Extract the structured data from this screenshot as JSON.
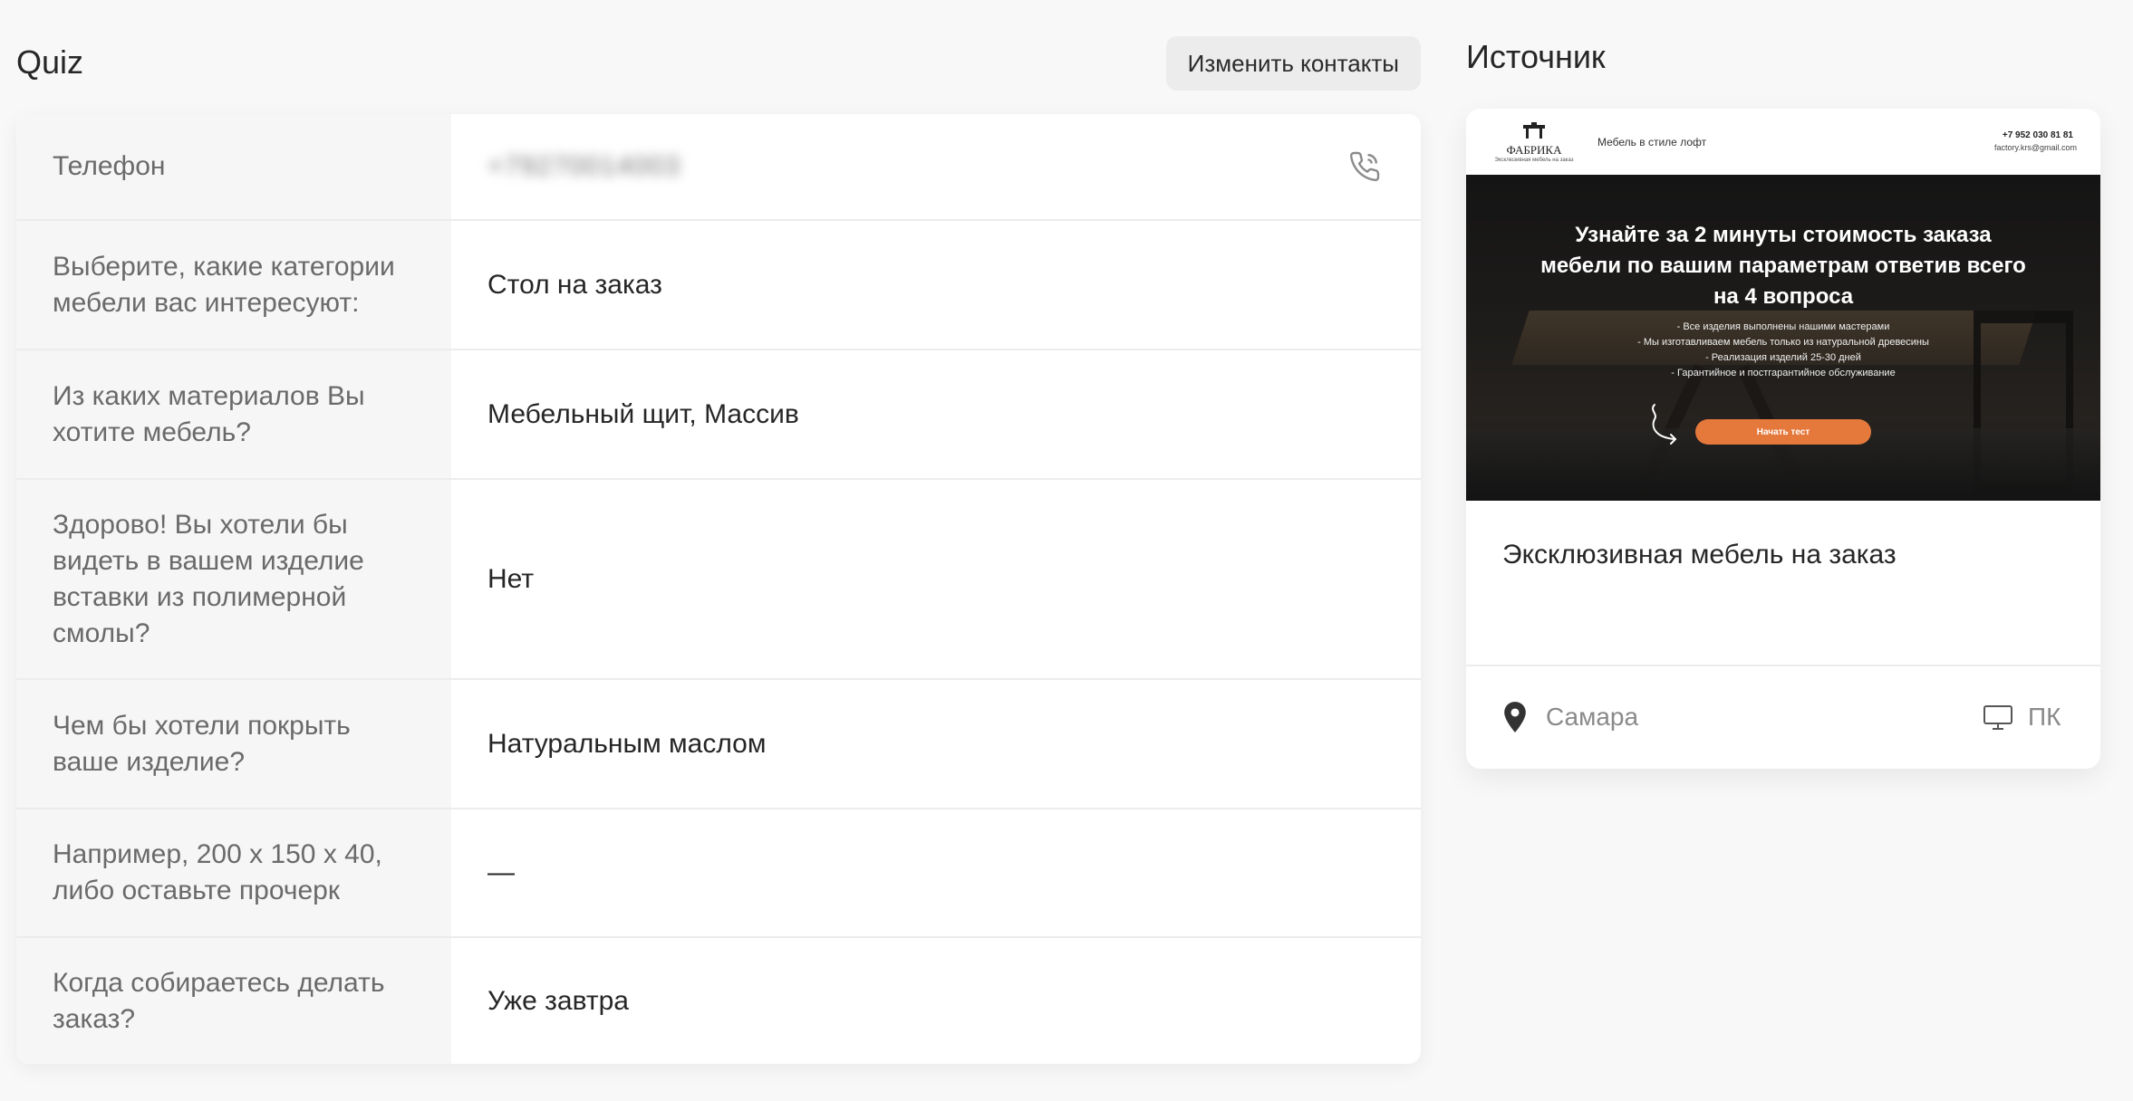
{
  "quiz": {
    "title": "Quiz",
    "change_contacts_label": "Изменить контакты",
    "rows": [
      {
        "question": "Телефон",
        "answer": "+79270014003",
        "answer_blurred": true
      },
      {
        "question": "Выберите, какие категории мебели вас интересуют:",
        "answer": "Стол на заказ"
      },
      {
        "question": "Из каких материалов Вы хотите мебель?",
        "answer": "Мебельный щит, Массив"
      },
      {
        "question": "Здорово! Вы хотели бы видеть в вашем изделие вставки из полимерной смолы?",
        "answer": "Нет"
      },
      {
        "question": "Чем бы хотели покрыть ваше изделие?",
        "answer": "Натуральным маслом"
      },
      {
        "question": "Например, 200 х 150 х 40, либо оставьте прочерк",
        "answer": "—"
      },
      {
        "question": "Когда собираетесь делать заказ?",
        "answer": "Уже завтра"
      }
    ]
  },
  "source": {
    "title": "Источник",
    "preview": {
      "logo_name": "ФАБРИКА",
      "logo_sub": "Эксклюзивная мебель на заказ",
      "nav_tagline": "Мебель в стиле лофт",
      "nav_phone": "+7 952 030 81 81",
      "nav_email": "factory.krs@gmail.com",
      "hero_title": "Узнайте за 2 минуты стоимость заказа мебели по вашим параметрам ответив всего на 4 вопроса",
      "hero_items": [
        "- Все изделия выполнены нашими мастерами",
        "- Мы изготавливаем мебель только из натуральной древесины",
        "- Реализация изделий 25-30 дней",
        "- Гарантийное и постгарантийное обслуживание"
      ],
      "hero_button": "Начать тест",
      "accent_color": "#e5783b"
    },
    "site_name": "Эксклюзивная мебель на заказ",
    "location": "Самара",
    "device": "ПК"
  }
}
